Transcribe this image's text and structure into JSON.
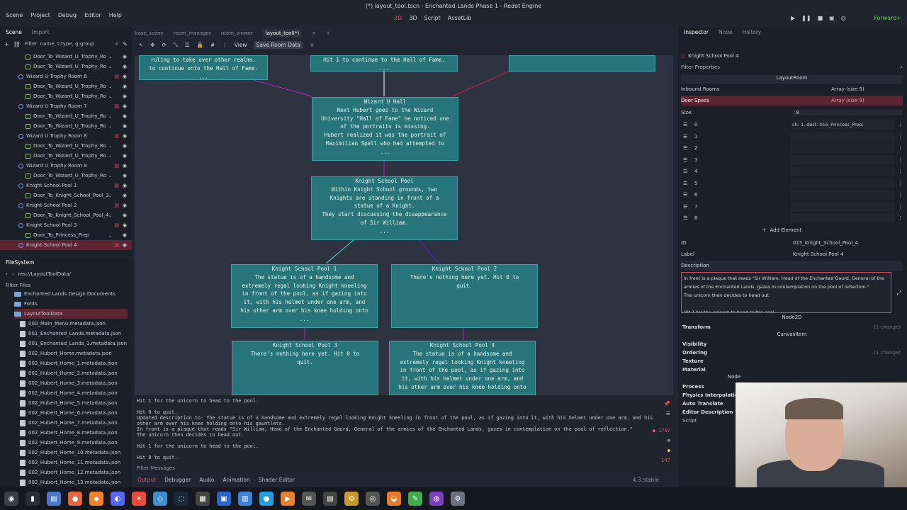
{
  "window": {
    "title": "(*) layout_tool.tscn - Enchanted Lands Phase 1 - Redot Engine"
  },
  "menu": [
    "Scene",
    "Project",
    "Debug",
    "Editor",
    "Help"
  ],
  "workspaces": [
    "2D",
    "3D",
    "Script",
    "AssetLib"
  ],
  "renderer": "Forward+",
  "scene_tabs": [
    "Scene",
    "Import"
  ],
  "scene_filter": "Filter: name, t:type, g:group",
  "scene_tree": [
    {
      "label": "Door_To_Wizard_U_Trophy_Ro",
      "indent": 2,
      "t": "d"
    },
    {
      "label": "Door_To_Wizard_U_Trophy_Ro",
      "indent": 2,
      "t": "d"
    },
    {
      "label": "Wizard U Trophy Room 6",
      "indent": 1,
      "t": "r"
    },
    {
      "label": "Door_To_Wizard_U_Trophy_Ro",
      "indent": 2,
      "t": "d"
    },
    {
      "label": "Door_To_Wizard_U_Trophy_Ro",
      "indent": 2,
      "t": "d"
    },
    {
      "label": "Wizard U Trophy Room 7",
      "indent": 1,
      "t": "r"
    },
    {
      "label": "Door_To_Wizard_U_Trophy_Ro",
      "indent": 2,
      "t": "d"
    },
    {
      "label": "Door_To_Wizard_U_Trophy_Ro",
      "indent": 2,
      "t": "d"
    },
    {
      "label": "Wizard U Trophy Room 8",
      "indent": 1,
      "t": "r"
    },
    {
      "label": "Door_To_Wizard_U_Trophy_Ro",
      "indent": 2,
      "t": "d"
    },
    {
      "label": "Door_To_Wizard_U_Trophy_Ro",
      "indent": 2,
      "t": "d"
    },
    {
      "label": "Wizard U Trophy Room 9",
      "indent": 1,
      "t": "r"
    },
    {
      "label": "Door_To_Wizard_U_Trophy_Ro",
      "indent": 2,
      "t": "d"
    },
    {
      "label": "Knight School Pool 1",
      "indent": 1,
      "t": "r"
    },
    {
      "label": "Door_To_Knight_School_Pool_3",
      "indent": 2,
      "t": "d"
    },
    {
      "label": "Knight School Pool 2",
      "indent": 1,
      "t": "r"
    },
    {
      "label": "Door_To_Knight_School_Pool_4",
      "indent": 2,
      "t": "d"
    },
    {
      "label": "Knight School Pool 3",
      "indent": 1,
      "t": "r"
    },
    {
      "label": "Door_To_Princess_Prep",
      "indent": 2,
      "t": "d"
    },
    {
      "label": "Knight School Pool 4",
      "indent": 1,
      "t": "r",
      "sel": true
    }
  ],
  "filesystem": {
    "title": "FileSystem",
    "path": "res://LayoutToolData/",
    "filter": "Filter Files",
    "items": [
      {
        "label": "Enchanted Lands Design Documents",
        "type": "folder"
      },
      {
        "label": "Fonts",
        "type": "folder"
      },
      {
        "label": "LayoutToolData",
        "type": "folder",
        "sel": true
      },
      {
        "label": "000_Main_Menu.metadata.json",
        "type": "file"
      },
      {
        "label": "001_Enchanted_Lands.metadata.json",
        "type": "file"
      },
      {
        "label": "001_Enchanted_Lands_1.metadata.json",
        "type": "file"
      },
      {
        "label": "002_Hubert_Home.metadata.json",
        "type": "file"
      },
      {
        "label": "002_Hubert_Home_1.metadata.json",
        "type": "file"
      },
      {
        "label": "002_Hubert_Home_2.metadata.json",
        "type": "file"
      },
      {
        "label": "002_Hubert_Home_3.metadata.json",
        "type": "file"
      },
      {
        "label": "002_Hubert_Home_4.metadata.json",
        "type": "file"
      },
      {
        "label": "002_Hubert_Home_5.metadata.json",
        "type": "file"
      },
      {
        "label": "002_Hubert_Home_6.metadata.json",
        "type": "file"
      },
      {
        "label": "002_Hubert_Home_7.metadata.json",
        "type": "file"
      },
      {
        "label": "002_Hubert_Home_8.metadata.json",
        "type": "file"
      },
      {
        "label": "002_Hubert_Home_9.metadata.json",
        "type": "file"
      },
      {
        "label": "002_Hubert_Home_10.metadata.json",
        "type": "file"
      },
      {
        "label": "002_Hubert_Home_11.metadata.json",
        "type": "file"
      },
      {
        "label": "002_Hubert_Home_12.metadata.json",
        "type": "file"
      },
      {
        "label": "002_Hubert_Home_13.metadata.json",
        "type": "file"
      }
    ]
  },
  "editor_tabs": [
    "base_scene",
    "room_manager",
    "room_viewer",
    "layout_tool(*)"
  ],
  "editor_toolbar": {
    "view": "View",
    "save": "Save Room Data"
  },
  "nodes": [
    {
      "id": "top_left",
      "title": "",
      "body": "ruling to take over other realms.\nto continue onto the Hall of Fame.\n..."
    },
    {
      "id": "top_mid",
      "title": "",
      "body": "Hit 1 to continue to the Hall of Fame.\n..."
    },
    {
      "id": "top_right",
      "title": "",
      "body": ""
    },
    {
      "id": "wizard_hall",
      "title": "Wizard U Hall",
      "body": "Next Hubert goes to the Wizard\nUniversity \"Hall of Fame\" he noticed one\nof the portraits is missing.\nHubert realized it was the portrait of\nMaximilian Spell who had attempted to\n..."
    },
    {
      "id": "ksp",
      "title": "Knight School Pool",
      "body": "Within Knight School grounds, two\nKnights are standing in front of a\nstatue of a Knight.\nThey start discussing the disappearance\nof Sir William.\n..."
    },
    {
      "id": "ksp1",
      "title": "Knight School Pool 1",
      "body": "The statue is of a handsome and\nextremely regal looking Knight kneeling\nin front of the pool, as if gazing into\nit, with his helmet under one arm, and\nhis other arm over his knee holding onto\n..."
    },
    {
      "id": "ksp2",
      "title": "Knight School Pool 2",
      "body": "There's nothing here yet.  Hit 0 to\nquit."
    },
    {
      "id": "ksp3",
      "title": "Knight School Pool 3",
      "body": "There's nothing here yet.  Hit 0 to\nquit."
    },
    {
      "id": "ksp4",
      "title": "Knight School Pool 4",
      "body": "The statue is of a handsome and\nextremely regal looking Knight kneeling\nin front of the pool, as if gazing into\nit, with his helmet under one arm, and\nhis other arm over his knee holding onto"
    }
  ],
  "output_lines": [
    "Hit 1 for the unicorn to head to the pool.",
    "",
    "Hit 0 to quit.",
    "Updated description to: The statue is of a handsome and extremely regal looking Knight kneeling in front of the pool, as if gazing into it, with his helmet under one arm, and his",
    "other arm over his knee holding onto his gauntlets.",
    "In front is a plaque that reads \"Sir William, Head of the Enchanted Gaurd, General of the armies of the Enchanted Lands, gazes in contemplation on the pool of reflection.\"",
    "The unicorn then decides to head out.",
    "",
    "Hit 1 for the unicorn to head to the pool.",
    "",
    "Hit 0 to quit."
  ],
  "output_filter": "Filter Messages",
  "counts": {
    "c1": "1797",
    "c2": "147"
  },
  "bottom_tabs": [
    "Output",
    "Debugger",
    "Audio",
    "Animation",
    "Shader Editor"
  ],
  "version": "4.3.stable",
  "inspector": {
    "tabs": [
      "Inspector",
      "Node",
      "History"
    ],
    "object": "Knight School Pool 4",
    "filter": "Filter Properties",
    "class": "LayoutRoom",
    "inbound_label": "Inbound Rooms",
    "inbound_value": "Array (size 9)",
    "door_label": "Door Specs",
    "door_value": "Array (size 9)",
    "size_label": "Size:",
    "size_value": "9",
    "elements": [
      {
        "i": "0",
        "v": "ch: 1, dest: 016_Princess_Prep;"
      },
      {
        "i": "1",
        "v": ""
      },
      {
        "i": "2",
        "v": ""
      },
      {
        "i": "3",
        "v": ""
      },
      {
        "i": "4",
        "v": ""
      },
      {
        "i": "5",
        "v": ""
      },
      {
        "i": "6",
        "v": ""
      },
      {
        "i": "7",
        "v": ""
      },
      {
        "i": "8",
        "v": ""
      }
    ],
    "add_element": "Add Element",
    "id_label": "ID",
    "id_value": "015_Knight_School_Pool_4",
    "label_label": "Label",
    "label_value": "Knight School Pool 4",
    "desc_label": "Description",
    "desc_text": "In front is a plaque that reads \"Sir William, Head of the Enchanted Gaurd, General of the armies of the Enchanted Lands, gazes in contemplation on the pool of reflection.\"\nThe unicorn then decides to head out.\n\nHit 1 for the unicorn to head to the pool.",
    "node2d": "Node2D",
    "transform": "Transform",
    "canvasitem": "CanvasItem",
    "change": "(1 change)",
    "visibility": "Visibility",
    "ordering": "Ordering",
    "texture": "Texture",
    "material": "Material",
    "node": "Node",
    "process": "Process",
    "physics": "Physics Interpolation",
    "autotranslate": "Auto Translate",
    "editordesc": "Editor Description",
    "script": "Script"
  }
}
